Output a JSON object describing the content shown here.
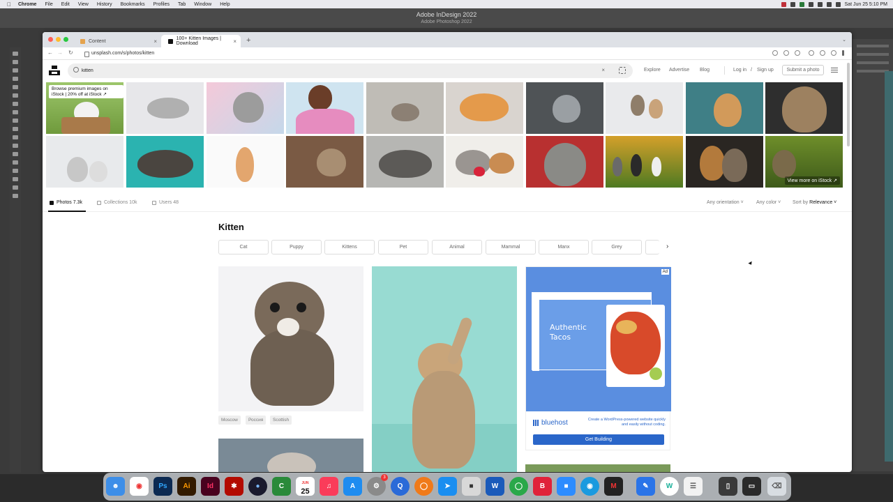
{
  "menubar": {
    "app": "Chrome",
    "items": [
      "File",
      "Edit",
      "View",
      "History",
      "Bookmarks",
      "Profiles",
      "Tab",
      "Window",
      "Help"
    ],
    "clock": "Sat Jun 25 5:10 PM"
  },
  "indesign": {
    "title": "Adobe InDesign 2022",
    "subtitle": "Adobe Photoshop 2022"
  },
  "browser": {
    "tabs": [
      {
        "label": "Content",
        "icon": "content-favicon"
      },
      {
        "label": "100+ Kitten Images | Download",
        "icon": "unsplash-favicon"
      }
    ],
    "url": "unsplash.com/s/photos/kitten"
  },
  "unsplash": {
    "search_value": "kitten",
    "nav": {
      "explore": "Explore",
      "advertise": "Advertise",
      "blog": "Blog",
      "login": "Log in",
      "slash": "/",
      "signup": "Sign up",
      "submit": "Submit a photo"
    },
    "istock_promo": "Browse premium images on iStock | 20% off at iStock ↗",
    "view_more": "View more on iStock ↗",
    "tabs": {
      "photos": "Photos 7.3k",
      "collections": "Collections 10k",
      "users": "Users 48"
    },
    "filters": {
      "orientation": "Any orientation ˅",
      "color": "Any color ˅",
      "sort_prefix": "Sort by",
      "sort_value": "Relevance ˅"
    },
    "page_title": "Kitten",
    "chips": [
      "Cat",
      "Puppy",
      "Kittens",
      "Pet",
      "Animal",
      "Mammal",
      "Manx",
      "Grey"
    ],
    "photo_tags": [
      "Moscow",
      "Россия",
      "Scottish"
    ],
    "ad": {
      "label": "Ad",
      "headline": "Authentic Tacos",
      "brand": "bluehost",
      "copy": "Create a WordPress-powered website quickly and easily without coding.",
      "cta": "Get Building"
    }
  },
  "colors": {
    "accent": "#2a66c9",
    "ad_blue": "#5a8ee0"
  },
  "dock": {
    "calendar_month": "JUN",
    "calendar_day": "25",
    "badge": "3"
  }
}
